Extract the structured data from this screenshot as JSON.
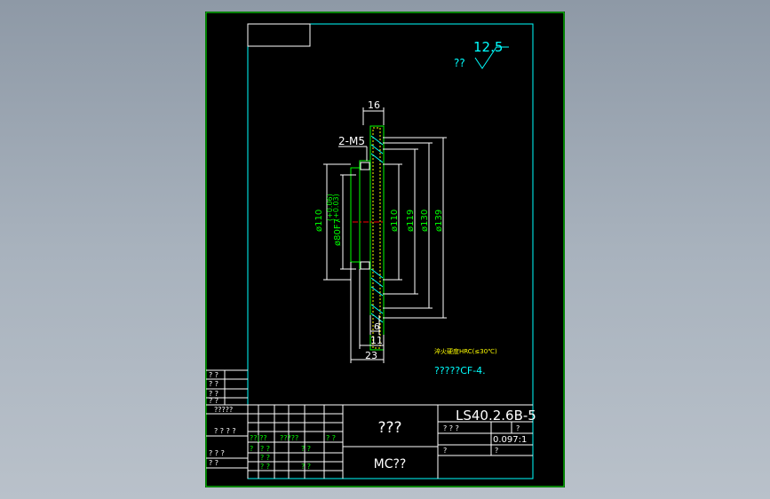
{
  "roughness": {
    "value": "12.5",
    "prefix": "??"
  },
  "dimensions": {
    "d16": "16",
    "m5": "2-M5",
    "d110_left": "ø110",
    "d80f7": "ø80F7",
    "tol_upper": "(+0.06)",
    "tol_lower": "(+0.03)",
    "d110": "ø110",
    "d119": "ø119",
    "d130": "ø130",
    "d139": "ø139",
    "d6": "6",
    "d11": "11",
    "d23": "23"
  },
  "notes": {
    "line1": "淬火硬度HRC(≤30℃)",
    "line2": "?????CF-4."
  },
  "title_block": {
    "part_name": "???",
    "material": "MC??",
    "drawing_no": "LS40.2.6B-5",
    "scale": "0.097:1",
    "left_cells": [
      "? ?",
      "? ?",
      "? ?",
      "? ?",
      "?????",
      "? ? ? ?",
      "? ? ?",
      "? ?"
    ],
    "grid_cells": [
      "??|??",
      "?????",
      "? ?",
      "?",
      "? ?",
      "? ?",
      "? ?",
      "? ?",
      "? ?"
    ],
    "right_cells": [
      "? ? ?",
      "?",
      "?",
      "?"
    ]
  }
}
